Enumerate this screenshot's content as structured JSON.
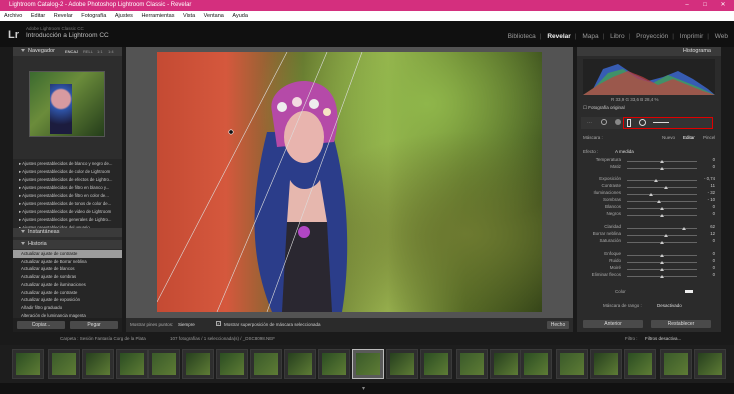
{
  "window": {
    "title": "Lightroom Catalog-2 - Adobe Photoshop Lightroom Classic - Revelar",
    "minimize_glyph": "–",
    "maximize_glyph": "□",
    "close_glyph": "✕"
  },
  "menu": [
    "Archivo",
    "Editar",
    "Revelar",
    "Fotografía",
    "Ajustes",
    "Herramientas",
    "Vista",
    "Ventana",
    "Ayuda"
  ],
  "header": {
    "logo": "Lr",
    "catalog_line1": "Adobe Lightroom Classic CC",
    "catalog_line2": "Introducción a Lightroom CC",
    "modules": [
      "Biblioteca",
      "Revelar",
      "Mapa",
      "Libro",
      "Proyección",
      "Imprimir",
      "Web"
    ],
    "active_module": "Revelar",
    "module_separator": "|"
  },
  "left_panel": {
    "navigator_title": "Navegador",
    "navigator_zoom": [
      "ENCAJ",
      "RELL",
      "1:1",
      "1:4"
    ],
    "presets": [
      "Ajustes preestablecidos de blanco y negro de...",
      "Ajustes preestablecidos de color de Lightroom",
      "Ajustes preestablecidos de efectos de Lightro...",
      "Ajustes preestablecidos de filtro en blanco y...",
      "Ajustes preestablecidos de filtro en color de...",
      "Ajustes preestablecidos de tonos de color de...",
      "Ajustes preestablecidos de video de Lightroom",
      "Ajustes preestablecidos generales de Lightro...",
      "Ajustes preestablecidos del usuario"
    ],
    "snapshots_title": "Instantáneas",
    "history_title": "Historia",
    "history": [
      "Actualizar ajuste de contraste",
      "Actualizar ajuste de Borrar neblina",
      "Actualizar ajuste de blancos",
      "Actualizar ajuste de sombras",
      "Actualizar ajuste de iluminaciones",
      "Actualizar ajuste de contraste",
      "Actualizar ajuste de exposición",
      "Añadir filtro graduado",
      "Alteración de luminancia magenta",
      "Alteración de luminancia púrpura"
    ],
    "copy_label": "Copiar...",
    "paste_label": "Pegar"
  },
  "toolbar": {
    "show_pins_label": "Mostrar pines puntos:",
    "show_pins_value": "Siempre",
    "overlay_label": "Mostrar superposición de máscara seleccionada",
    "done_label": "Hecho"
  },
  "right_panel": {
    "histogram_title": "Histograma",
    "rgb_readout": "R  33,9   G  33,6   B  28,4  %",
    "original_photo": "Fotografía original",
    "mask_label": "Máscara :",
    "mask_new": "Nuevo",
    "mask_edit": "Editar",
    "mask_brush": "Pincel",
    "effect_label": "Efecto :",
    "effect_value": "A medida",
    "sliders": [
      {
        "label": "Temperatura",
        "value": "0",
        "pos": 0.5
      },
      {
        "label": "Matiz",
        "value": "0",
        "pos": 0.5
      },
      {
        "label": "Exposición",
        "value": "- 0,74",
        "pos": 0.41
      },
      {
        "label": "Contraste",
        "value": "11",
        "pos": 0.55
      },
      {
        "label": "Iluminaciones",
        "value": "- 32",
        "pos": 0.34
      },
      {
        "label": "Sombras",
        "value": "- 10",
        "pos": 0.45
      },
      {
        "label": "Blancos",
        "value": "0",
        "pos": 0.5
      },
      {
        "label": "Negros",
        "value": "0",
        "pos": 0.5
      },
      {
        "label": "Claridad",
        "value": "62",
        "pos": 0.81
      },
      {
        "label": "Borrar neblina",
        "value": "12",
        "pos": 0.56
      },
      {
        "label": "Saturación",
        "value": "0",
        "pos": 0.5
      },
      {
        "label": "Enfoque",
        "value": "0",
        "pos": 0.5
      },
      {
        "label": "Ruido",
        "value": "0",
        "pos": 0.5
      },
      {
        "label": "Moiré",
        "value": "0",
        "pos": 0.5
      },
      {
        "label": "Eliminar flecos",
        "value": "0",
        "pos": 0.5
      }
    ],
    "color_label": "Color",
    "range_mask_label": "Máscara de rango :",
    "range_mask_value": "Desactivado",
    "previous_label": "Anterior",
    "reset_label": "Restablecer"
  },
  "filmstrip": {
    "folder": "Carpeta : Sesión Fantasía Corg de la Plata",
    "count": "107 fotografías / 1 seleccionada(s) / _DSC8098.NEF",
    "filter_label": "Filtro :",
    "filter_value": "Filtros desactiva..."
  },
  "colors": {
    "accent_title": "#d42f7e",
    "highlight_box": "#e00000"
  }
}
